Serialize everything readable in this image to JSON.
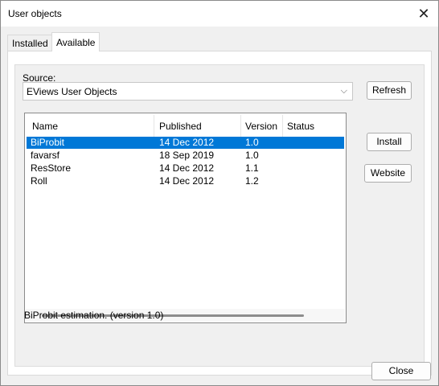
{
  "window": {
    "title": "User objects",
    "close_glyph": "✕"
  },
  "tabs": [
    {
      "label": "Installed",
      "selected": false
    },
    {
      "label": "Available",
      "selected": true
    }
  ],
  "source": {
    "label": "Source:",
    "value": "EViews User Objects",
    "arrow": "⌵"
  },
  "buttons": {
    "refresh": "Refresh",
    "install": "Install",
    "website": "Website",
    "close": "Close"
  },
  "list": {
    "columns": [
      "Name",
      "Published",
      "Version",
      "Status"
    ],
    "rows": [
      {
        "name": "BiProbit",
        "published": "14 Dec 2012",
        "version": "1.0",
        "status": "",
        "selected": true
      },
      {
        "name": "favarsf",
        "published": "18 Sep 2019",
        "version": "1.0",
        "status": "",
        "selected": false
      },
      {
        "name": "ResStore",
        "published": "14 Dec 2012",
        "version": "1.1",
        "status": "",
        "selected": false
      },
      {
        "name": "Roll",
        "published": "14 Dec 2012",
        "version": "1.2",
        "status": "",
        "selected": false
      }
    ]
  },
  "description": "BiProbit estimation. (version 1.0)",
  "colors": {
    "selection": "#0078d7",
    "dialog_bg": "#f0f0f0"
  }
}
